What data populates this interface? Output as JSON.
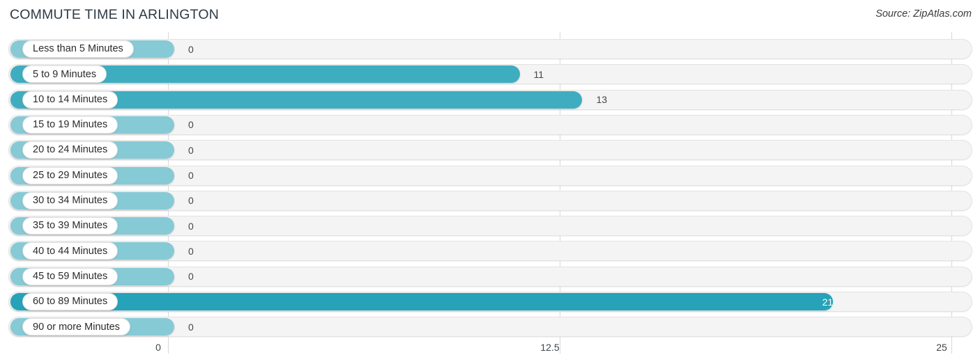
{
  "header": {
    "title": "COMMUTE TIME IN ARLINGTON",
    "source": "Source: ZipAtlas.com"
  },
  "colors": {
    "bar_primary": "#3fadc0",
    "bar_highlight": "#26a3b8",
    "bar_zero": "#86cad6",
    "track_fill": "#f4f4f4",
    "track_border": "#e3e3e3",
    "gridline": "#d8d8d8",
    "title_text": "#2f3a44",
    "value_text": "#41464b",
    "label_text": "#2b2b2b"
  },
  "chart_data": {
    "type": "bar",
    "orientation": "horizontal",
    "title": "COMMUTE TIME IN ARLINGTON",
    "xlabel": "",
    "ylabel": "",
    "xlim": [
      0,
      25
    ],
    "grid": true,
    "legend": null,
    "x_ticks": [
      "0",
      "12.5",
      "25"
    ],
    "x_tick_values": [
      0,
      12.5,
      25
    ],
    "categories": [
      "Less than 5 Minutes",
      "5 to 9 Minutes",
      "10 to 14 Minutes",
      "15 to 19 Minutes",
      "20 to 24 Minutes",
      "25 to 29 Minutes",
      "30 to 34 Minutes",
      "35 to 39 Minutes",
      "40 to 44 Minutes",
      "45 to 59 Minutes",
      "60 to 89 Minutes",
      "90 or more Minutes"
    ],
    "values": [
      0,
      11,
      13,
      0,
      0,
      0,
      0,
      0,
      0,
      0,
      21,
      0
    ],
    "value_labels": [
      "0",
      "11",
      "13",
      "0",
      "0",
      "0",
      "0",
      "0",
      "0",
      "0",
      "21",
      "0"
    ]
  },
  "rows": [
    {
      "label": "Less than 5 Minutes",
      "value": 0,
      "value_label": "0",
      "inside": false
    },
    {
      "label": "5 to 9 Minutes",
      "value": 11,
      "value_label": "11",
      "inside": false
    },
    {
      "label": "10 to 14 Minutes",
      "value": 13,
      "value_label": "13",
      "inside": false
    },
    {
      "label": "15 to 19 Minutes",
      "value": 0,
      "value_label": "0",
      "inside": false
    },
    {
      "label": "20 to 24 Minutes",
      "value": 0,
      "value_label": "0",
      "inside": false
    },
    {
      "label": "25 to 29 Minutes",
      "value": 0,
      "value_label": "0",
      "inside": false
    },
    {
      "label": "30 to 34 Minutes",
      "value": 0,
      "value_label": "0",
      "inside": false
    },
    {
      "label": "35 to 39 Minutes",
      "value": 0,
      "value_label": "0",
      "inside": false
    },
    {
      "label": "40 to 44 Minutes",
      "value": 0,
      "value_label": "0",
      "inside": false
    },
    {
      "label": "45 to 59 Minutes",
      "value": 0,
      "value_label": "0",
      "inside": false
    },
    {
      "label": "60 to 89 Minutes",
      "value": 21,
      "value_label": "21",
      "inside": true
    },
    {
      "label": "90 or more Minutes",
      "value": 0,
      "value_label": "0",
      "inside": false
    }
  ]
}
